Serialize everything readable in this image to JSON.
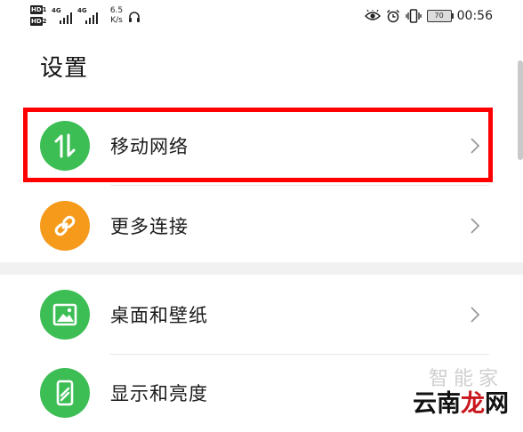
{
  "status_bar": {
    "hd1": "HD",
    "hd1_sub": "1",
    "hd2": "HD",
    "hd2_sub": "2",
    "net1": "4G",
    "net2": "4G",
    "speed_value": "6.5",
    "speed_unit": "K/s",
    "battery": "70",
    "time": "00:56",
    "icons": [
      "eye-comfort-icon",
      "alarm-icon",
      "vibrate-icon",
      "headset-icon"
    ]
  },
  "header": {
    "title": "设置"
  },
  "settings": {
    "items": [
      {
        "label": "移动网络",
        "icon": "mobile-data-icon",
        "color": "#3dbe55"
      },
      {
        "label": "更多连接",
        "icon": "link-icon",
        "color": "#f59a1b"
      },
      {
        "label": "桌面和壁纸",
        "icon": "image-icon",
        "color": "#3dbe55"
      },
      {
        "label": "显示和亮度",
        "icon": "phone-brightness-icon",
        "color": "#3dbe55"
      }
    ]
  },
  "highlight": {
    "color": "#ff0000"
  },
  "watermark": {
    "top": "智能家",
    "text_main": "云南",
    "text_accent": "龙",
    "text_end": "网"
  }
}
